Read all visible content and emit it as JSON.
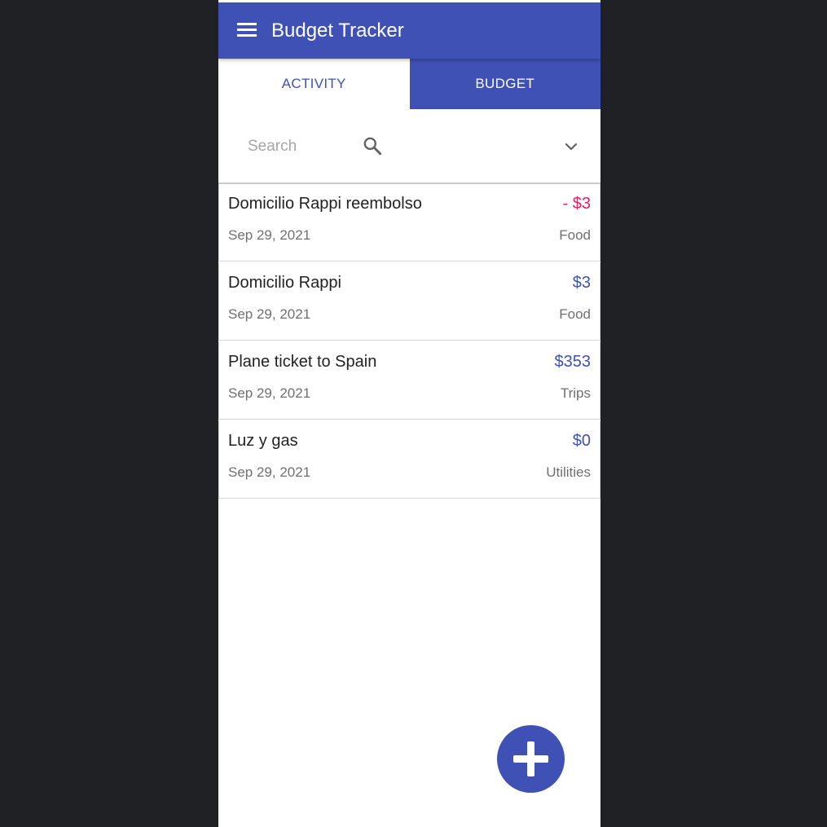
{
  "app": {
    "title": "Budget Tracker"
  },
  "tabs": [
    {
      "label": "ACTIVITY",
      "selected": false
    },
    {
      "label": "BUDGET",
      "selected": true
    }
  ],
  "search": {
    "placeholder": "Search",
    "value": ""
  },
  "transactions": [
    {
      "name": "Domicilio Rappi reembolso",
      "amount": "- $3",
      "date": "Sep 29, 2021",
      "category": "Food"
    },
    {
      "name": "Domicilio Rappi",
      "amount": "$3",
      "date": "Sep 29, 2021",
      "category": "Food"
    },
    {
      "name": "Plane ticket to Spain",
      "amount": "$353",
      "date": "Sep 29, 2021",
      "category": "Trips"
    },
    {
      "name": "Luz y gas",
      "amount": "$0",
      "date": "Sep 29, 2021",
      "category": "Utilities"
    }
  ],
  "icons": {
    "menu": "menu-icon",
    "search": "search-icon",
    "expand": "chevron-down-icon",
    "add": "plus-icon"
  },
  "colors": {
    "primary": "#3f51b5",
    "negative": "#e91e63",
    "background": "#202124"
  }
}
